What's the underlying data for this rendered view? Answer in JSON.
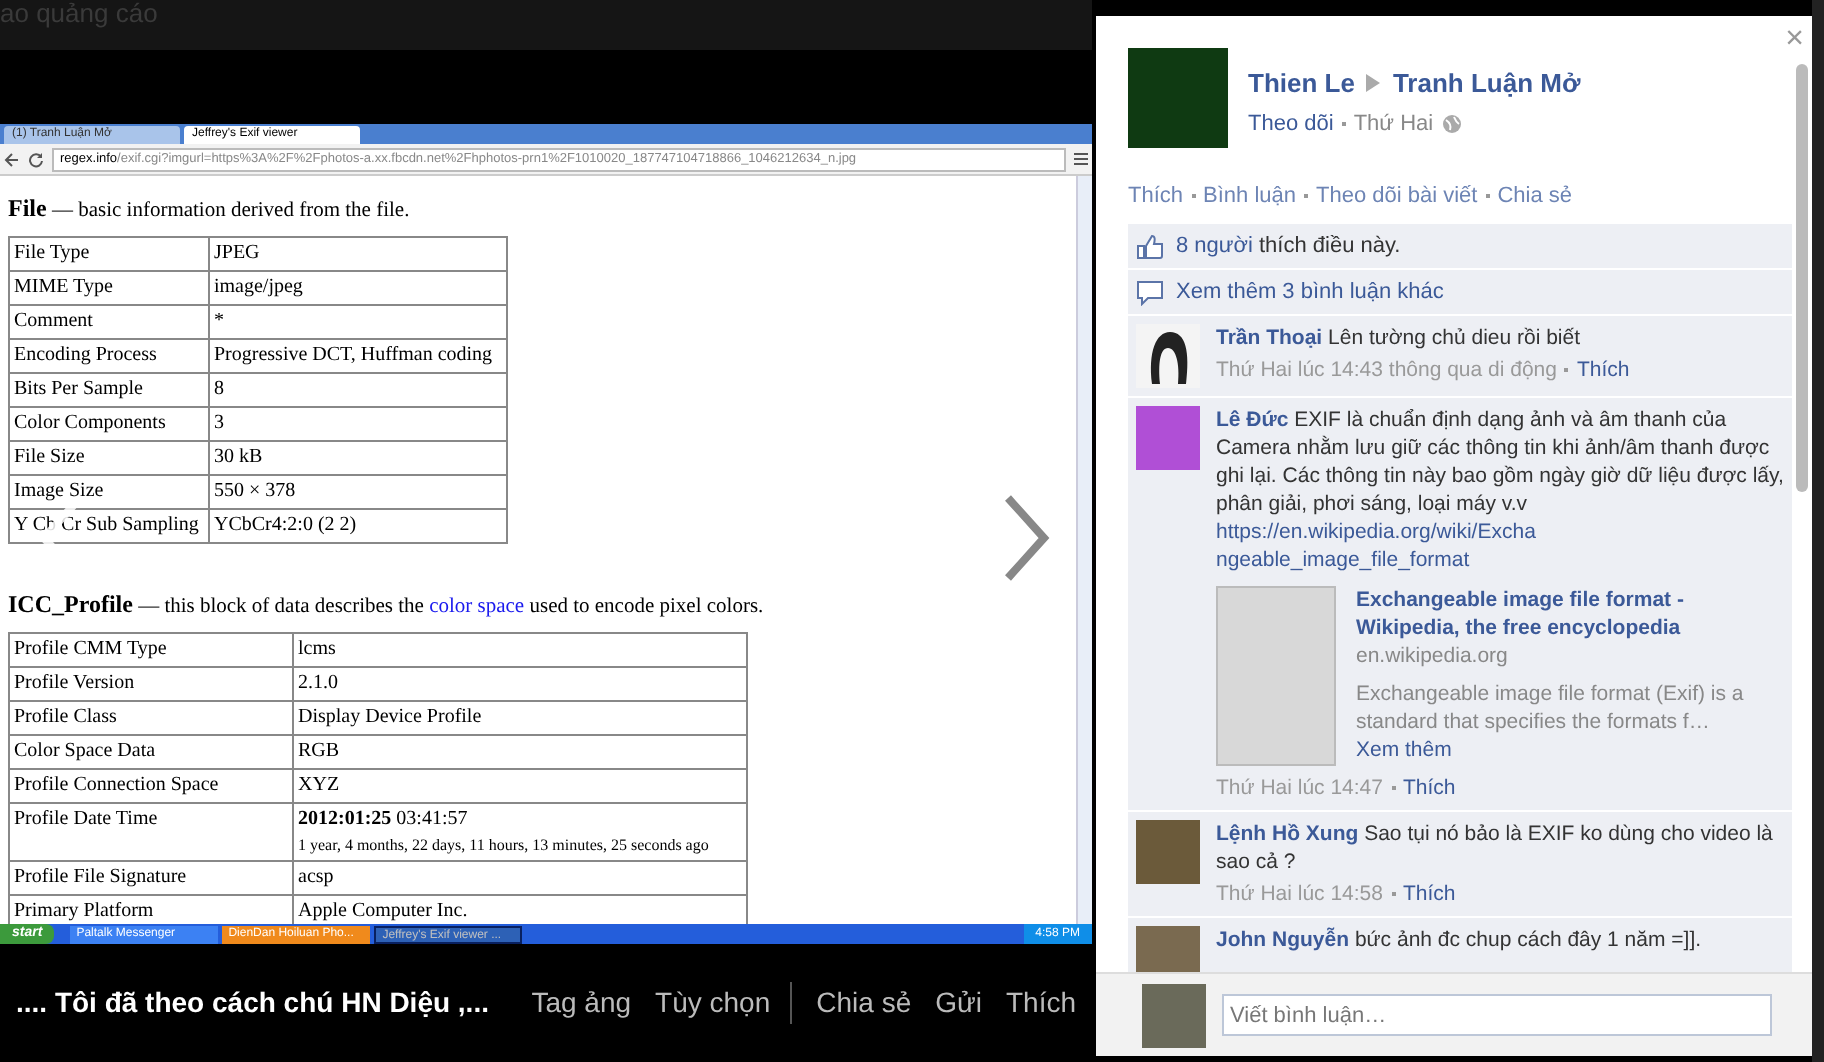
{
  "background": {
    "ad_text": "ao quảng cáo"
  },
  "photo": {
    "browser": {
      "tabs": [
        {
          "label": "(1) Tranh Luận Mở",
          "selected": false
        },
        {
          "label": "Jeffrey's Exif viewer",
          "selected": true
        }
      ],
      "url_host": "regex.info",
      "url_path": "/exif.cgi?imgurl=https%3A%2F%2Fphotos-a.xx.fbcdn.net%2Fhphotos-prn1%2F1010020_187747104718866_1046212634_n.jpg",
      "sections": [
        {
          "title": "File",
          "text_before": "— basic information derived from the file.",
          "rows": [
            {
              "name": "File Type",
              "value": "JPEG"
            },
            {
              "name": "MIME Type",
              "value": "image/jpeg"
            },
            {
              "name": "Comment",
              "value": "*"
            },
            {
              "name": "Encoding Process",
              "value": "Progressive DCT, Huffman coding"
            },
            {
              "name": "Bits Per Sample",
              "value": "8"
            },
            {
              "name": "Color Components",
              "value": "3"
            },
            {
              "name": "File Size",
              "value": "30 kB"
            },
            {
              "name": "Image Size",
              "value": "550 × 378"
            },
            {
              "name": "Y Cb Cr Sub Sampling",
              "value": "YCbCr4:2:0 (2 2)"
            }
          ]
        },
        {
          "title": "ICC_Profile",
          "text_before": "— this block of data describes the",
          "link": "color space",
          "text_after": "used to encode pixel colors.",
          "rows": [
            {
              "name": "Profile CMM Type",
              "value": "lcms"
            },
            {
              "name": "Profile Version",
              "value": "2.1.0"
            },
            {
              "name": "Profile Class",
              "value": "Display Device Profile"
            },
            {
              "name": "Color Space Data",
              "value": "RGB"
            },
            {
              "name": "Profile Connection Space",
              "value": "XYZ"
            },
            {
              "name": "Profile Date Time",
              "value": "**2012:01:25** 03:41:57",
              "note": "1 year, 4 months, 22 days, 11 hours, 13 minutes, 25 seconds ago"
            },
            {
              "name": "Profile File Signature",
              "value": "acsp"
            },
            {
              "name": "Primary Platform",
              "value": "Apple Computer Inc."
            }
          ]
        }
      ]
    },
    "taskbar": {
      "start": "start",
      "items": [
        {
          "label": "Paltalk Messenger",
          "selected": false,
          "flashing": false
        },
        {
          "label": "DienDan Hoiluan Pho...",
          "selected": false,
          "flashing": true
        },
        {
          "label": "Jeffrey's Exif viewer ...",
          "selected": true,
          "flashing": false
        }
      ],
      "clock": "4:58 PM"
    }
  },
  "caption_bar": {
    "caption": ".... Tôi đã theo cách chú HN Diệu ,...",
    "actions": [
      {
        "label": "Tag ảng",
        "divider_after": false
      },
      {
        "label": "Tùy chọn",
        "divider_after": true
      },
      {
        "label": "Chia sẻ",
        "divider_after": false
      },
      {
        "label": "Gửi",
        "divider_after": false
      },
      {
        "label": "Thích",
        "divider_after": false
      }
    ]
  },
  "panel": {
    "close": "×",
    "author": "Thien Le",
    "group": "Tranh Luận Mở",
    "follow": "Theo dõi",
    "date": "Thứ Hai",
    "actions": [
      "Thích",
      "Bình luận",
      "Theo dõi bài viết",
      "Chia sẻ"
    ],
    "likes": {
      "count_link": "8 người",
      "text": "thích điều này."
    },
    "view_more": "Xem thêm 3 bình luận khác",
    "comments": [
      {
        "author": "Trần Thoại",
        "text": "Lên tường chủ dieu rồi biết",
        "time": "Thứ Hai lúc 14:43 thông qua di động",
        "like": "Thích",
        "kind": "silhouette"
      },
      {
        "author": "Lê Đức",
        "text": "EXIF là chuẩn định dạng ảnh và âm thanh của Camera nhằm lưu giữ các thông tin khi ảnh/âm thanh được ghi lại. Các thông tin này bao gồm ngày giờ dữ liệu được lấy, phân giải, phơi sáng, loại máy v.v",
        "link": "https://en.wikipedia.org/wiki/Exchangeable_image_file_format",
        "preview": {
          "title": "Exchangeable image file format - Wikipedia, the free encyclopedia",
          "domain": "en.wikipedia.org",
          "summary": "Exchangeable image file format (Exif) is a standard that specifies the formats f…",
          "more": "Xem thêm"
        },
        "time": "Thứ Hai lúc 14:47",
        "like": "Thích",
        "kind": "photo"
      },
      {
        "author": "Lệnh Hồ Xung",
        "text": "Sao tụi nó bảo là EXIF ko dùng cho video là sao cả ?",
        "time": "Thứ Hai lúc 14:58",
        "like": "Thích",
        "kind": "photo"
      },
      {
        "author": "John Nguyễn",
        "text": "bức ảnh đc chup cách đây 1 năm =]].",
        "kind": "photo"
      }
    ],
    "comment_box": {
      "placeholder": "Viết bình luận…"
    }
  }
}
